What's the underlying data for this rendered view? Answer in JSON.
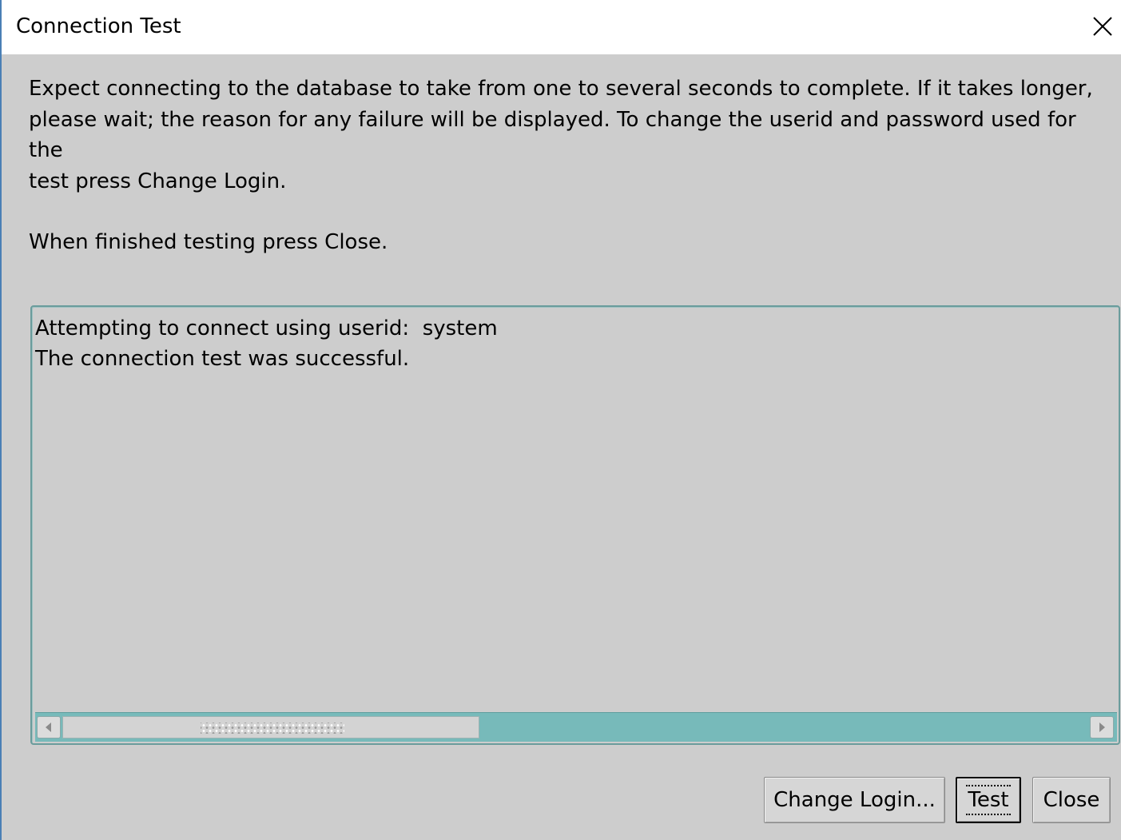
{
  "window": {
    "title": "Connection Test",
    "close_icon": "close-x-icon"
  },
  "instructions": {
    "line1": "Expect connecting to the database to take from one to several seconds to complete. If it takes longer,",
    "line2": "please wait; the reason for any failure will be displayed. To change the userid and password used for the",
    "line3": "test press Change Login.",
    "line4": "When finished testing press Close."
  },
  "log": {
    "lines": [
      "Attempting to connect using userid:  system",
      "The connection test was successful."
    ]
  },
  "scrollbar": {
    "left_icon": "arrow-left-icon",
    "right_icon": "arrow-right-icon",
    "thumb_fraction": 0.38
  },
  "buttons": {
    "change_login": "Change Login...",
    "test": "Test",
    "close": "Close"
  },
  "colors": {
    "dialog_background": "#cdcdcd",
    "scrollbar_track": "#77baba",
    "border_accent": "#4a7fb5"
  }
}
